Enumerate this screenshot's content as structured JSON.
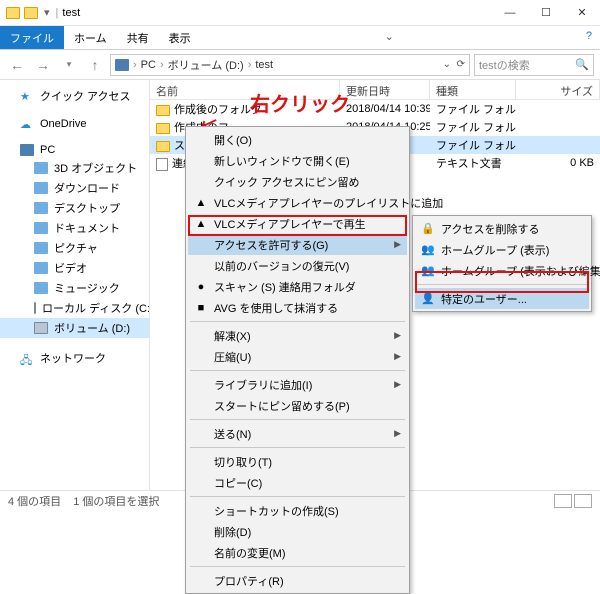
{
  "title": "test",
  "ribbon": {
    "file": "ファイル",
    "home": "ホーム",
    "share": "共有",
    "view": "表示"
  },
  "breadcrumb": [
    "PC",
    "ボリューム (D:)",
    "test"
  ],
  "search_placeholder": "testの検索",
  "nav": {
    "quick": "クイック アクセス",
    "onedrive": "OneDrive",
    "pc": "PC",
    "pc_items": [
      "3D オブジェクト",
      "ダウンロード",
      "デスクトップ",
      "ドキュメント",
      "ピクチャ",
      "ビデオ",
      "ミュージック",
      "ローカル ディスク (C:)",
      "ボリューム (D:)"
    ],
    "network": "ネットワーク"
  },
  "cols": {
    "name": "名前",
    "date": "更新日時",
    "type": "種類",
    "size": "サイズ"
  },
  "rows": [
    {
      "icon": "folder",
      "name": "作成後のフォルダ",
      "date": "2018/04/14 10:39",
      "type": "ファイル フォルダー",
      "size": ""
    },
    {
      "icon": "folder",
      "name": "作成中のフ",
      "date": "2018/04/14 10:25",
      "type": "ファイル フォルダー",
      "size": ""
    },
    {
      "icon": "folder",
      "name": "ス",
      "date": "",
      "type": "ファイル フォルダー",
      "size": "",
      "sel": true
    },
    {
      "icon": "doc",
      "name": "連絡",
      "date": "",
      "type": "テキスト文書",
      "size": "0 KB"
    }
  ],
  "status": {
    "count": "4 個の項目",
    "sel": "1 個の項目を選択"
  },
  "annotation": "右クリック",
  "ctx1": [
    {
      "t": "開く(O)"
    },
    {
      "t": "新しいウィンドウで開く(E)"
    },
    {
      "t": "クイック アクセスにピン留め"
    },
    {
      "t": "VLCメディアプレイヤーのプレイリストに追加",
      "ico": "▲"
    },
    {
      "t": "VLCメディアプレイヤーで再生",
      "ico": "▲"
    },
    {
      "t": "アクセスを許可する(G)",
      "sub": true,
      "hl": true
    },
    {
      "t": "以前のバージョンの復元(V)"
    },
    {
      "t": "スキャン (S) 連絡用フォルダ",
      "ico": "●"
    },
    {
      "t": "AVG を使用して抹消する",
      "ico": "■"
    },
    {
      "sep": true
    },
    {
      "t": "解凍(X)",
      "sub": true
    },
    {
      "t": "圧縮(U)",
      "sub": true
    },
    {
      "sep": true
    },
    {
      "t": "ライブラリに追加(I)",
      "sub": true
    },
    {
      "t": "スタートにピン留めする(P)"
    },
    {
      "sep": true
    },
    {
      "t": "送る(N)",
      "sub": true
    },
    {
      "sep": true
    },
    {
      "t": "切り取り(T)"
    },
    {
      "t": "コピー(C)"
    },
    {
      "sep": true
    },
    {
      "t": "ショートカットの作成(S)"
    },
    {
      "t": "削除(D)"
    },
    {
      "t": "名前の変更(M)"
    },
    {
      "sep": true
    },
    {
      "t": "プロパティ(R)"
    }
  ],
  "ctx2": [
    {
      "t": "アクセスを削除する",
      "ico": "🔒"
    },
    {
      "t": "ホームグループ (表示)",
      "ico": "👥"
    },
    {
      "t": "ホームグループ (表示および編集)",
      "ico": "👥"
    },
    {
      "sep": true
    },
    {
      "t": "特定のユーザー...",
      "ico": "👤",
      "hl": true
    }
  ]
}
